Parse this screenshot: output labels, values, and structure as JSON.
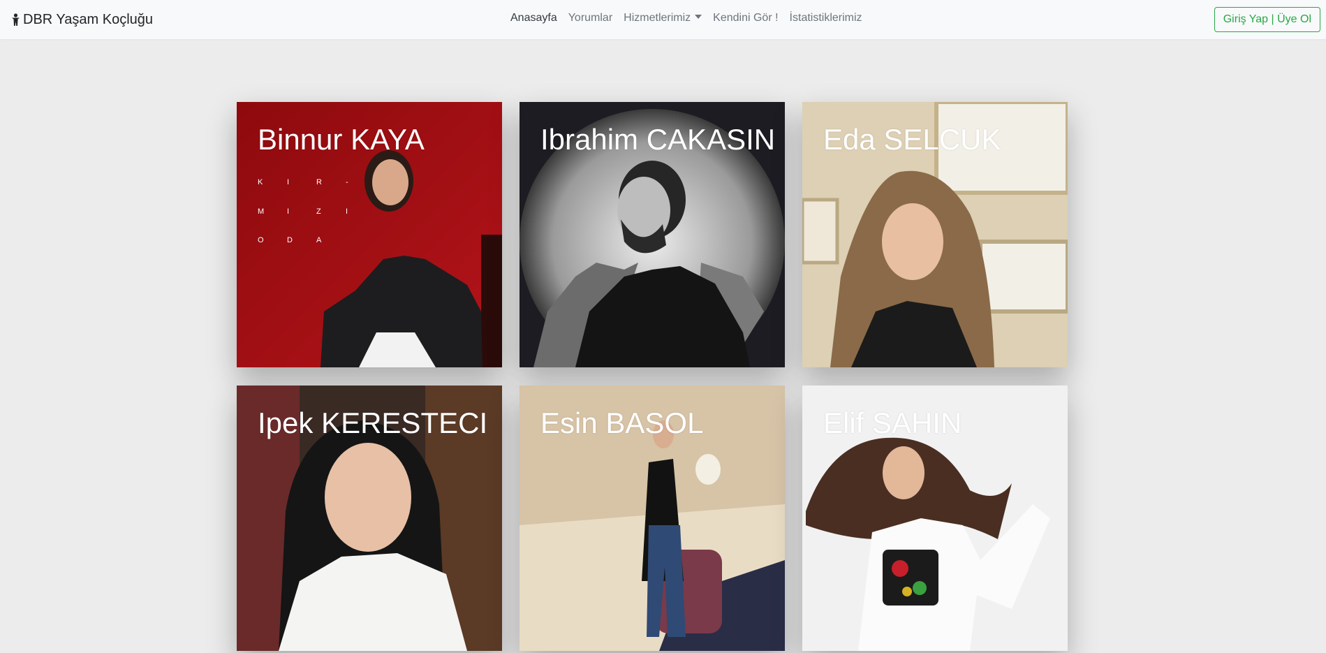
{
  "brand": {
    "icon": "person-icon",
    "name": "DBR Yaşam Koçluğu"
  },
  "nav": {
    "items": [
      {
        "label": "Anasayfa",
        "active": true
      },
      {
        "label": "Yorumlar"
      },
      {
        "label": "Hizmetlerimiz",
        "dropdown": true
      },
      {
        "label": "Kendini Gör !"
      },
      {
        "label": "İstatistiklerimiz"
      }
    ],
    "login_label": "Giriş Yap | Üye Ol"
  },
  "coaches": [
    {
      "name": "Binnur KAYA",
      "photo_letters": [
        "K",
        "I",
        "R",
        "-",
        "M",
        "I",
        "Z",
        "I",
        "O",
        "D",
        "A"
      ]
    },
    {
      "name": "Ibrahim CAKASIN"
    },
    {
      "name": "Eda SELCUK"
    },
    {
      "name": "Ipek KERESTECI"
    },
    {
      "name": "Esin BASOL"
    },
    {
      "name": "Elif SAHIN"
    }
  ],
  "colors": {
    "accent": "#28a745",
    "background": "#ececec",
    "navbar": "#f8f9fa"
  }
}
